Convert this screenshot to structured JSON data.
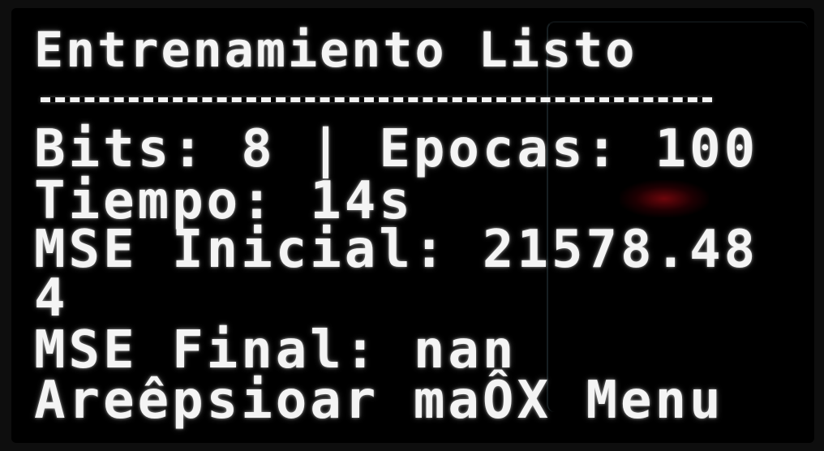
{
  "display": {
    "title": "Entrenamiento Listo",
    "lines": [
      "Bits: 8 | Epocas: 100",
      "Tiempo: 14s",
      "MSE Inicial: 21578.48",
      "4",
      "MSE Final: nan",
      "Areêpsioar maÔX Menu"
    ]
  },
  "colors": {
    "text": "#f4f4f4",
    "background": "#000000",
    "led": "#c80a14"
  }
}
